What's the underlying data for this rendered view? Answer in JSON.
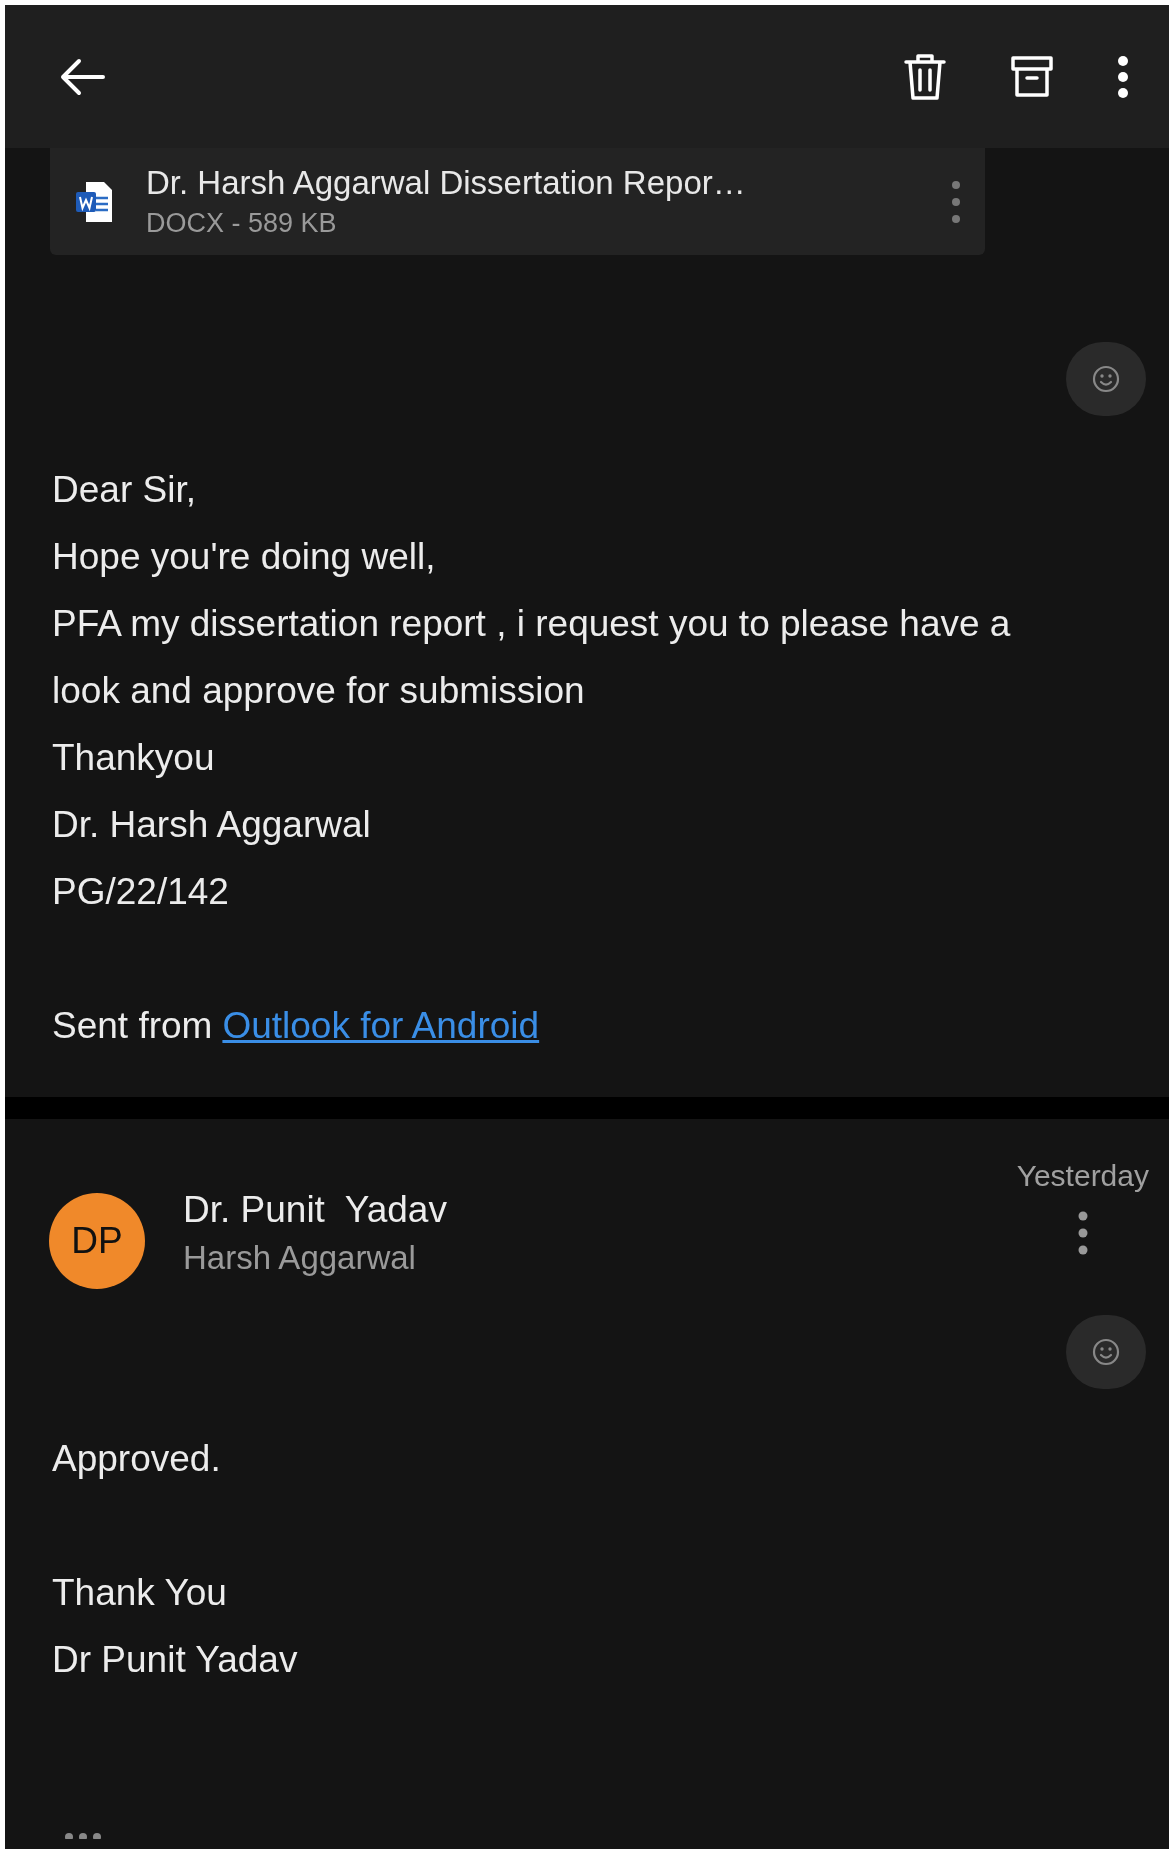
{
  "messages": [
    {
      "kind": "continued",
      "attachment": {
        "name": "Dr. Harsh Aggarwal Dissertation Repor…",
        "meta": "DOCX - 589 KB"
      },
      "paragraphs": [
        [
          "Dear Sir,",
          "Hope you're doing well,",
          "PFA my dissertation report , i request you to please have a look and approve for submission",
          "Thankyou",
          "Dr. Harsh Aggarwal",
          "PG/22/142"
        ]
      ],
      "footer": {
        "text": "Sent from",
        "link": "Outlook for Android"
      }
    },
    {
      "kind": "full",
      "sender": {
        "initials": "DP",
        "color": "#f0892a",
        "name": "Dr. Punit  Yadav",
        "recipient": "Harsh Aggarwal",
        "time": "Yesterday"
      },
      "paragraphs": [
        [
          "Approved."
        ],
        [
          "Thank You",
          "Dr Punit Yadav"
        ]
      ]
    }
  ]
}
